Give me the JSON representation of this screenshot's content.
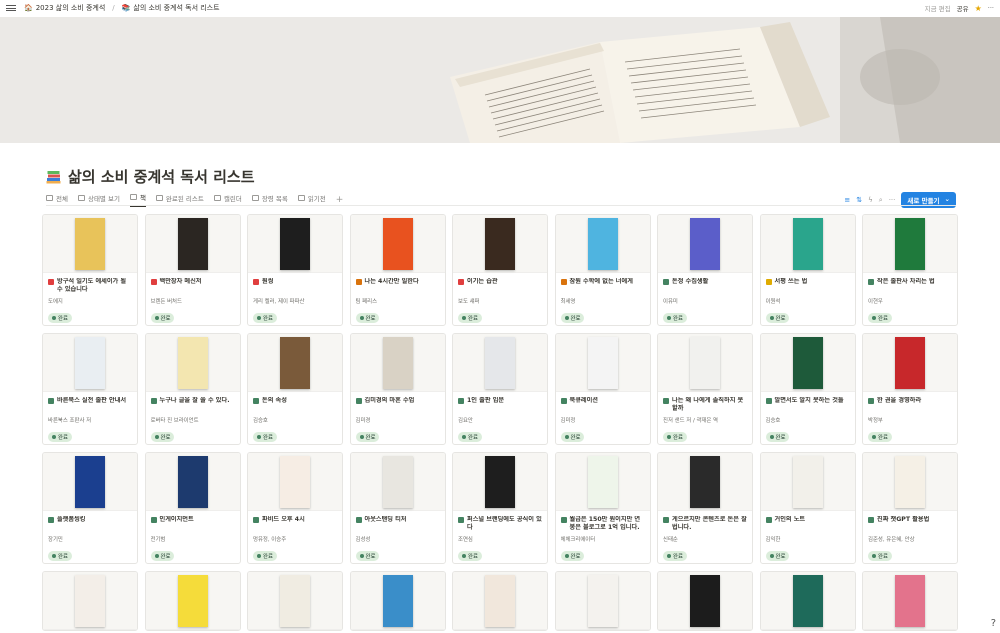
{
  "topbar": {
    "breadcrumb": [
      {
        "icon": "🏠",
        "label": "2023 삶의 소비 중계석"
      },
      {
        "icon": "📚",
        "label": "삶의 소비 중계석 독서 리스트"
      }
    ],
    "edited": "지금 편집",
    "share": "공유"
  },
  "page": {
    "title": "삶의 소비 중계석 독서 리스트"
  },
  "tabs": [
    {
      "label": "전체"
    },
    {
      "label": "상태별 보기"
    },
    {
      "label": "책"
    },
    {
      "label": "완료된 리스트"
    },
    {
      "label": "캘린더"
    },
    {
      "label": "장령 목록"
    },
    {
      "label": "읽기전"
    }
  ],
  "toolbar": {
    "new_label": "새로 만들기"
  },
  "status_label": "완료",
  "colors": {
    "accent": "#2383e2",
    "status_bg": "#dbeddb",
    "status_dot": "#448361"
  },
  "books": [
    {
      "title": "방구석 일기도 에세이가 될 수 있습니다",
      "author": "도에지",
      "icon": "red",
      "cover": "#e8c35a"
    },
    {
      "title": "백만장자 메신저",
      "author": "브렌든 버처드",
      "icon": "red",
      "cover": "#2b2622"
    },
    {
      "title": "원씽",
      "author": "게리 켈러, 제이 파파산",
      "icon": "red",
      "cover": "#1e1e1e"
    },
    {
      "title": "나는 4시간만 일한다",
      "author": "팀 페리스",
      "icon": "orange",
      "cover": "#e8521f"
    },
    {
      "title": "이기는 습관",
      "author": "보도 섀퍼",
      "icon": "red",
      "cover": "#3a2a1f"
    },
    {
      "title": "잠원 수학에 없는 너에게",
      "author": "최세영",
      "icon": "orange",
      "cover": "#4fb4e0"
    },
    {
      "title": "돈정 수집생활",
      "author": "이유미",
      "icon": "green",
      "cover": "#5b5ec9"
    },
    {
      "title": "서평 쓰는 법",
      "author": "이원석",
      "icon": "yellow",
      "cover": "#2aa58c"
    },
    {
      "title": "작은 출판사 차리는 법",
      "author": "이현우",
      "icon": "green",
      "cover": "#1f7a3c"
    },
    {
      "title": "바른북스 실전 출판 안내서",
      "author": "바른북스 조판사 저",
      "icon": "green",
      "cover": "#e9eef2"
    },
    {
      "title": "누구나 글을 잘 쓸 수 있다.",
      "author": "로버타 진 브라이언트",
      "icon": "green",
      "cover": "#f3e6b0"
    },
    {
      "title": "돈의 속성",
      "author": "김승호",
      "icon": "green",
      "cover": "#7a5a3a"
    },
    {
      "title": "김미경의 마흔 수업",
      "author": "김미경",
      "icon": "green",
      "cover": "#d9d2c5"
    },
    {
      "title": "1인 출판 입문",
      "author": "김요안",
      "icon": "green",
      "cover": "#e5e7ea"
    },
    {
      "title": "북큐레이션",
      "author": "김미정",
      "icon": "green",
      "cover": "#f4f4f4"
    },
    {
      "title": "나는 왜 나에게 솔직하지 못할까",
      "author": "진저 샌드 저 / 곽재은 역",
      "icon": "green",
      "cover": "#f1f1ee"
    },
    {
      "title": "알면서도 알지 못하는 것들",
      "author": "김승호",
      "icon": "green",
      "cover": "#1e5a3a"
    },
    {
      "title": "한 권을 경영하라",
      "author": "박정부",
      "icon": "green",
      "cover": "#c7282b"
    },
    {
      "title": "플랫폼씽킹",
      "author": "장기민",
      "icon": "green",
      "cover": "#1b3f8f"
    },
    {
      "title": "인게이지먼트",
      "author": "전기범",
      "icon": "green",
      "cover": "#1d3a6e"
    },
    {
      "title": "파비드 오후 4시",
      "author": "멍유정, 이승주",
      "icon": "green",
      "cover": "#f6ede4"
    },
    {
      "title": "아웃스탠딩 티처",
      "author": "김성성",
      "icon": "green",
      "cover": "#e8e6e0"
    },
    {
      "title": "퍼스널 브랜딩에도 공식이 있다",
      "author": "조연심",
      "icon": "green",
      "cover": "#1e1e1e"
    },
    {
      "title": "월급은 150만 원이지만 연봉은 블로그로 1억 입니다.",
      "author": "체체크리에이터",
      "icon": "green",
      "cover": "#eef5ea"
    },
    {
      "title": "게으르지만 콘텐츠로 돈은 잘 법니다.",
      "author": "신태순",
      "icon": "green",
      "cover": "#2a2a2a"
    },
    {
      "title": "거인의 노트",
      "author": "김익한",
      "icon": "green",
      "cover": "#f2f0ea"
    },
    {
      "title": "진짜 챗GPT 활용법",
      "author": "김준성, 유은혜, 안상",
      "icon": "green",
      "cover": "#f5f0e6"
    },
    {
      "cover": "#f3eee8"
    },
    {
      "cover": "#f5dc3a"
    },
    {
      "cover": "#f0ece2"
    },
    {
      "cover": "#3a8ec9"
    },
    {
      "cover": "#f1e7dc"
    },
    {
      "cover": "#f4f2ee"
    },
    {
      "cover": "#1c1c1c"
    },
    {
      "cover": "#1e6a5a"
    },
    {
      "cover": "#e3738c"
    }
  ]
}
